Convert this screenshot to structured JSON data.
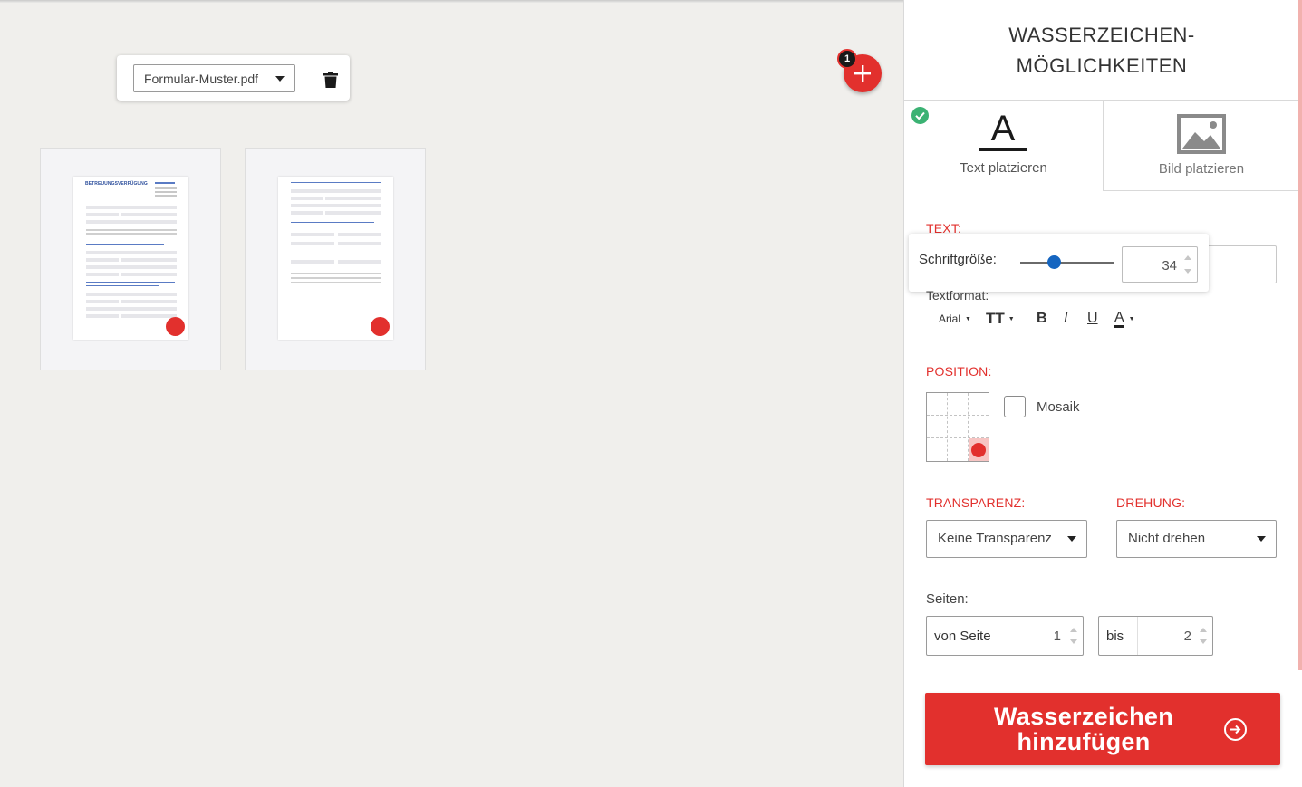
{
  "file": {
    "selected": "Formular-Muster.pdf",
    "count_badge": "1"
  },
  "thumbnails": [
    {
      "page": 1,
      "heading": "BETREUUNGSVERFÜGUNG"
    },
    {
      "page": 2
    }
  ],
  "panel": {
    "title_line1": "WASSERZEICHEN-",
    "title_line2": "MÖGLICHKEITEN",
    "tabs": {
      "text_label": "Text platzieren",
      "image_label": "Bild platzieren",
      "active": "text"
    },
    "text_section": {
      "label": "TEXT:",
      "font_size_label": "Schriftgröße:",
      "font_size_value": "34",
      "font_size_fraction": 0.34
    },
    "format": {
      "label": "Textformat:",
      "font": "Arial",
      "size_icon": "TT",
      "bold": "B",
      "italic": "I",
      "underline": "U",
      "color": "A",
      "color_hex": "#222222"
    },
    "position": {
      "label": "POSITION:",
      "selected_cell": "bottom-right",
      "mosaic_label": "Mosaik",
      "mosaic_checked": false
    },
    "transparency": {
      "label": "TRANSPARENZ:",
      "value": "Keine Transparenz"
    },
    "rotation": {
      "label": "DREHUNG:",
      "value": "Nicht drehen"
    },
    "pages": {
      "label": "Seiten:",
      "from_label": "von Seite",
      "from_value": "1",
      "to_label": "bis",
      "to_value": "2"
    },
    "cta": {
      "line1": "Wasserzeichen",
      "line2": "hinzufügen"
    }
  },
  "colors": {
    "accent": "#e2302d",
    "success": "#3bb273",
    "slider": "#1565c0"
  }
}
